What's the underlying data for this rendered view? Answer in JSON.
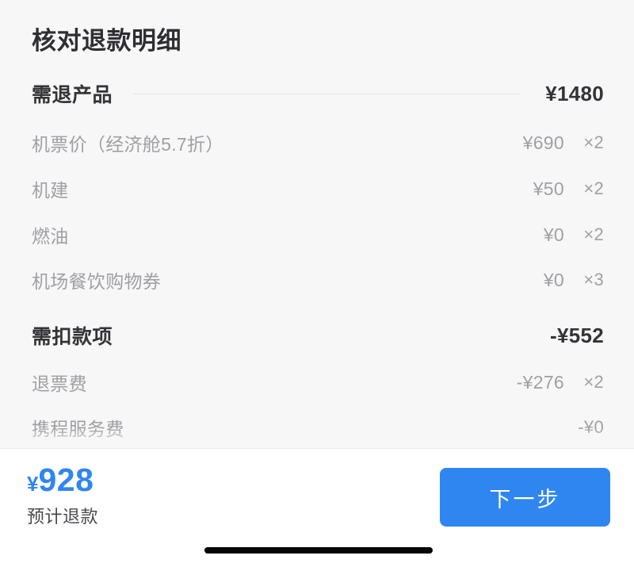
{
  "page": {
    "title": "核对退款明细"
  },
  "sections": [
    {
      "name": "refundable-products",
      "header": {
        "label": "需退产品",
        "amount": "¥1480"
      },
      "items": [
        {
          "label": "机票价（经济舱5.7折）",
          "amount": "¥690",
          "qty": "×2"
        },
        {
          "label": "机建",
          "amount": "¥50",
          "qty": "×2"
        },
        {
          "label": "燃油",
          "amount": "¥0",
          "qty": "×2"
        },
        {
          "label": "机场餐饮购物券",
          "amount": "¥0",
          "qty": "×3"
        }
      ]
    },
    {
      "name": "deductions",
      "header": {
        "label": "需扣款项",
        "amount": "-¥552"
      },
      "items": [
        {
          "label": "退票费",
          "amount": "-¥276",
          "qty": "×2"
        },
        {
          "label": "携程服务费",
          "amount": "-¥0",
          "qty": ""
        }
      ]
    }
  ],
  "bottom_bar": {
    "currency_symbol": "¥",
    "refund_value": "928",
    "refund_caption": "预计退款",
    "next_button_label": "下一步"
  },
  "colors": {
    "accent": "#2f86f0",
    "page_background": "#f7f7f8",
    "bar_background": "#ffffff",
    "primary_text": "#333338",
    "muted_text": "#a0a0a4",
    "divider": "#e4e4e6",
    "home_indicator": "#050505"
  }
}
